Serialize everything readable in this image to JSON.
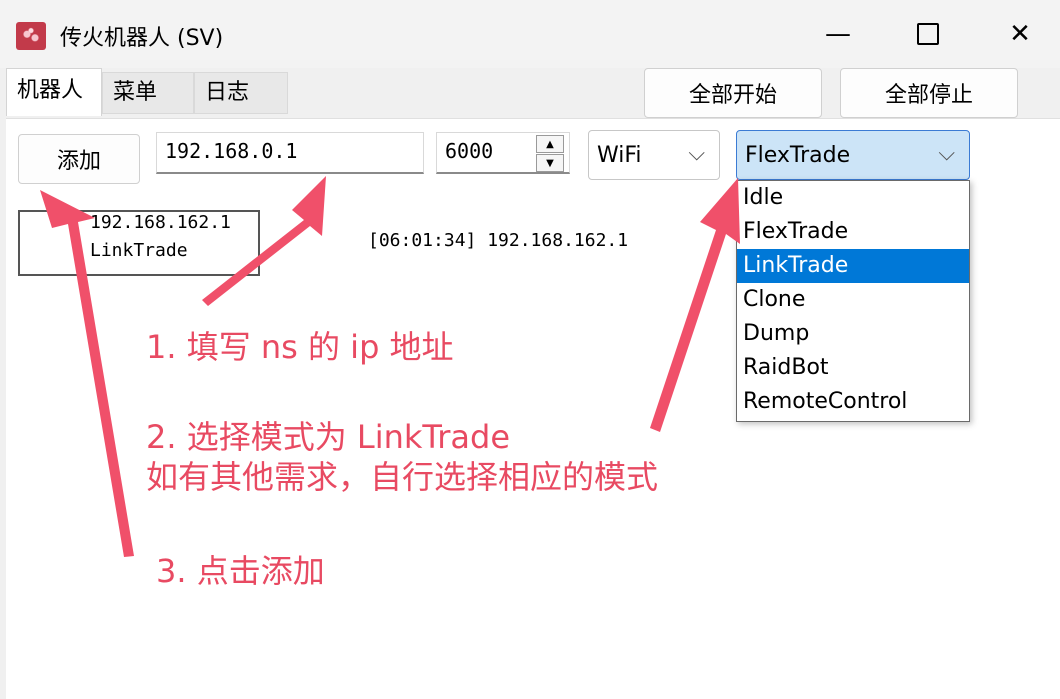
{
  "window": {
    "title": "传火机器人 (SV)",
    "controls": {
      "minimize": "—",
      "close": "✕"
    }
  },
  "tabs": [
    {
      "label": "机器人"
    },
    {
      "label": "菜单"
    },
    {
      "label": "日志"
    }
  ],
  "toolbar": {
    "start_all": "全部开始",
    "stop_all": "全部停止",
    "add": "添加"
  },
  "form": {
    "ip_value": "192.168.0.1",
    "port_value": "6000",
    "connection": "WiFi",
    "mode": "FlexTrade",
    "mode_options": [
      "Idle",
      "FlexTrade",
      "LinkTrade",
      "Clone",
      "Dump",
      "RaidBot",
      "RemoteControl"
    ],
    "highlighted_option": "LinkTrade"
  },
  "bots": [
    {
      "ip": "192.168.162.1",
      "mode": "LinkTrade",
      "log": "[06:01:34] 192.168.162.1"
    }
  ],
  "annotations": {
    "step1": "1. 填写 ns 的 ip 地址",
    "step2": "2. 选择模式为 LinkTrade",
    "step2b": "如有其他需求，自行选择相应的模式",
    "step3": "3. 点击添加",
    "color": "#e84a62"
  }
}
